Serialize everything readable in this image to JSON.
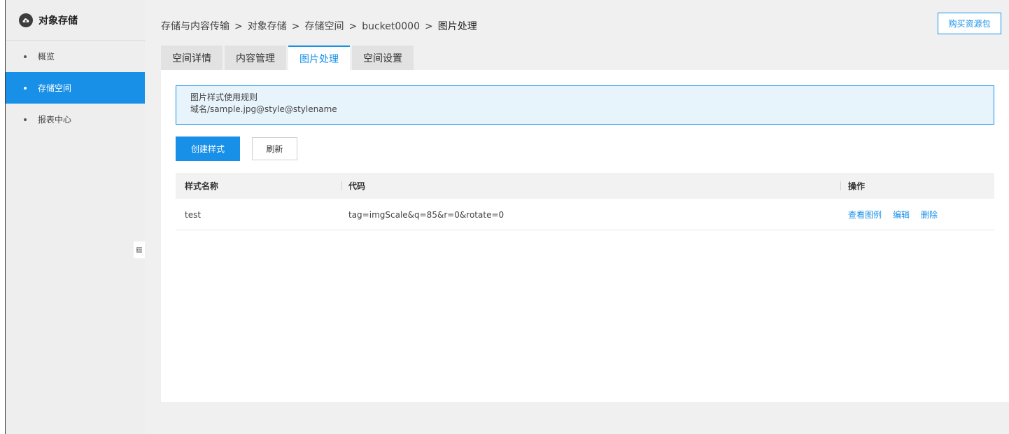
{
  "sidebar": {
    "title": "对象存储",
    "items": [
      {
        "label": "概览"
      },
      {
        "label": "存储空间"
      },
      {
        "label": "报表中心"
      }
    ]
  },
  "breadcrumb": [
    "存储与内容传输",
    "对象存储",
    "存储空间",
    "bucket0000",
    "图片处理"
  ],
  "breadcrumb_separator": ">",
  "header": {
    "buy_label": "购买资源包"
  },
  "tabs": [
    {
      "label": "空间详情"
    },
    {
      "label": "内容管理"
    },
    {
      "label": "图片处理"
    },
    {
      "label": "空间设置"
    }
  ],
  "notice": {
    "title": "图片样式使用规则",
    "rule": "域名/sample.jpg@style@stylename"
  },
  "actions": {
    "create_label": "创建样式",
    "refresh_label": "刷新"
  },
  "table": {
    "headers": [
      "样式名称",
      "代码",
      "操作"
    ],
    "rows": [
      {
        "name": "test",
        "code": "tag=imgScale&q=85&r=0&rotate=0",
        "ops": [
          "查看图例",
          "编辑",
          "删除"
        ]
      }
    ]
  },
  "colors": {
    "accent": "#1890e8",
    "sidebar_bg": "#eeeeee",
    "notice_bg": "#e8f4fc"
  }
}
